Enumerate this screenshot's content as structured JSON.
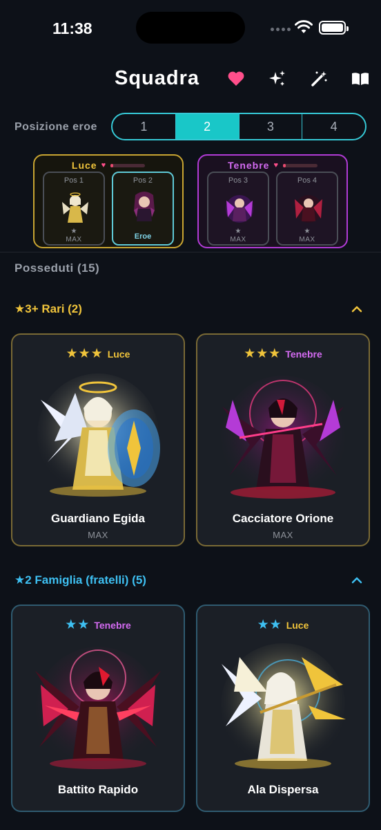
{
  "status_bar": {
    "time": "11:38"
  },
  "header": {
    "title": "Squadra",
    "icons": [
      "heart-icon",
      "sparkles-icon",
      "magic-wand-icon",
      "book-icon"
    ],
    "accent": "#ff4f8b"
  },
  "position_selector": {
    "label": "Posizione eroe",
    "options": [
      "1",
      "2",
      "3",
      "4"
    ],
    "selected": "2",
    "accent": "#19c7c8"
  },
  "teams": [
    {
      "name": "Luce",
      "hp_fraction": 0.08,
      "color": "#f0c43b",
      "slots": [
        {
          "label": "Pos 1",
          "star": "★",
          "status": "MAX",
          "selected": false
        },
        {
          "label": "Pos 2",
          "star": "",
          "status": "Eroe",
          "selected": true
        }
      ]
    },
    {
      "name": "Tenebre",
      "hp_fraction": 0.08,
      "color": "#d46bf2",
      "slots": [
        {
          "label": "Pos 3",
          "star": "★",
          "status": "MAX",
          "selected": false
        },
        {
          "label": "Pos 4",
          "star": "★",
          "status": "MAX",
          "selected": false
        }
      ]
    }
  ],
  "owned": {
    "label": "Posseduti (15)"
  },
  "sections": [
    {
      "title": "★3+ Rari (2)",
      "color": "#f0c43b",
      "expanded": true,
      "cards": [
        {
          "stars": "★★★",
          "element": "Luce",
          "name": "Guardiano Egida",
          "level": "MAX"
        },
        {
          "stars": "★★★",
          "element": "Tenebre",
          "name": "Cacciatore Orione",
          "level": "MAX"
        }
      ]
    },
    {
      "title": "★2 Famiglia (fratelli) (5)",
      "color": "#3ec0f2",
      "expanded": true,
      "cards": [
        {
          "stars": "★★",
          "element": "Tenebre",
          "name": "Battito Rapido"
        },
        {
          "stars": "★★",
          "element": "Luce",
          "name": "Ala Dispersa"
        }
      ]
    }
  ]
}
